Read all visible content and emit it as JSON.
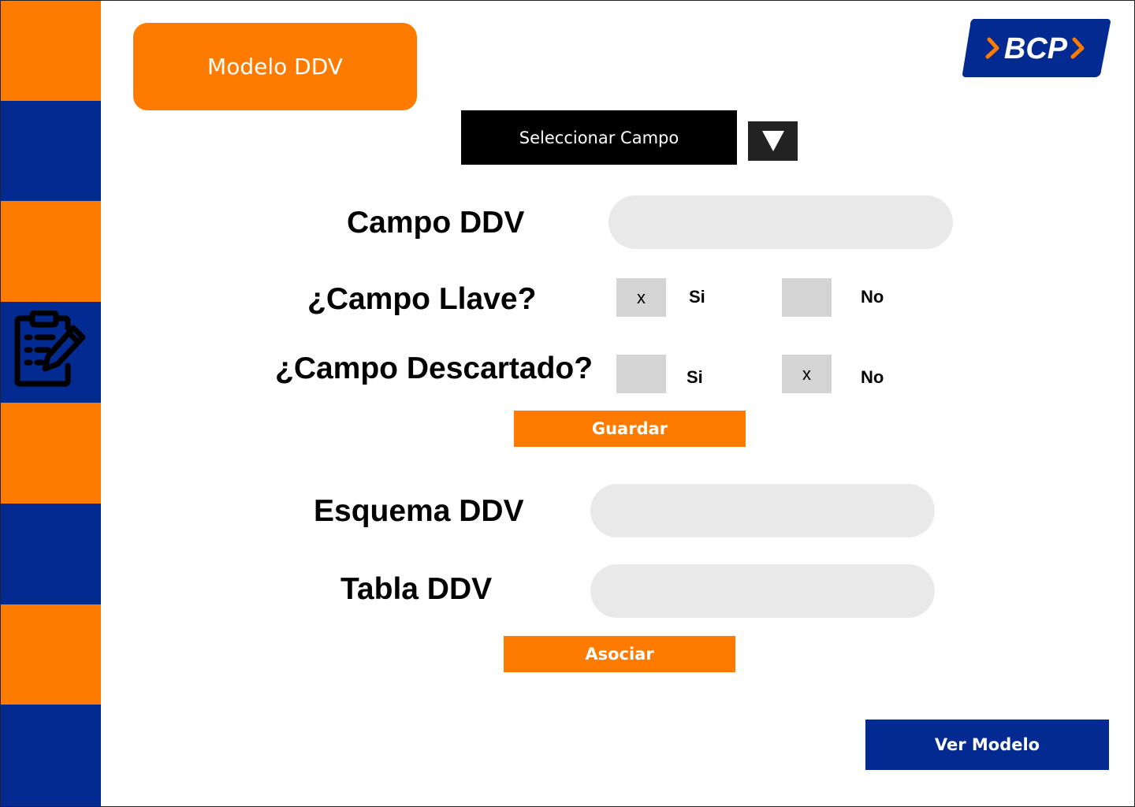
{
  "header": {
    "title": "Modelo DDV",
    "logo_text": "BCP"
  },
  "select": {
    "label": "Seleccionar Campo",
    "arrow_icon": "triangle-down-icon"
  },
  "form": {
    "campo_ddv": {
      "label": "Campo DDV",
      "value": ""
    },
    "campo_llave": {
      "label": "¿Campo Llave?",
      "si_label": "Si",
      "si_mark": "x",
      "no_label": "No",
      "no_mark": ""
    },
    "campo_descartado": {
      "label": "¿Campo Descartado?",
      "si_label": "Si",
      "si_mark": "",
      "no_label": "No",
      "no_mark": "x"
    },
    "guardar_label": "Guardar",
    "esquema_ddv": {
      "label": "Esquema DDV",
      "value": ""
    },
    "tabla_ddv": {
      "label": "Tabla DDV",
      "value": ""
    },
    "asociar_label": "Asociar"
  },
  "footer": {
    "ver_modelo_label": "Ver Modelo"
  },
  "colors": {
    "orange": "#ff7b00",
    "blue": "#022a91",
    "input_bg": "#e9e9e9",
    "checkbox_bg": "#d4d4d4"
  },
  "sidebar": {
    "icon": "edit-document-icon"
  }
}
